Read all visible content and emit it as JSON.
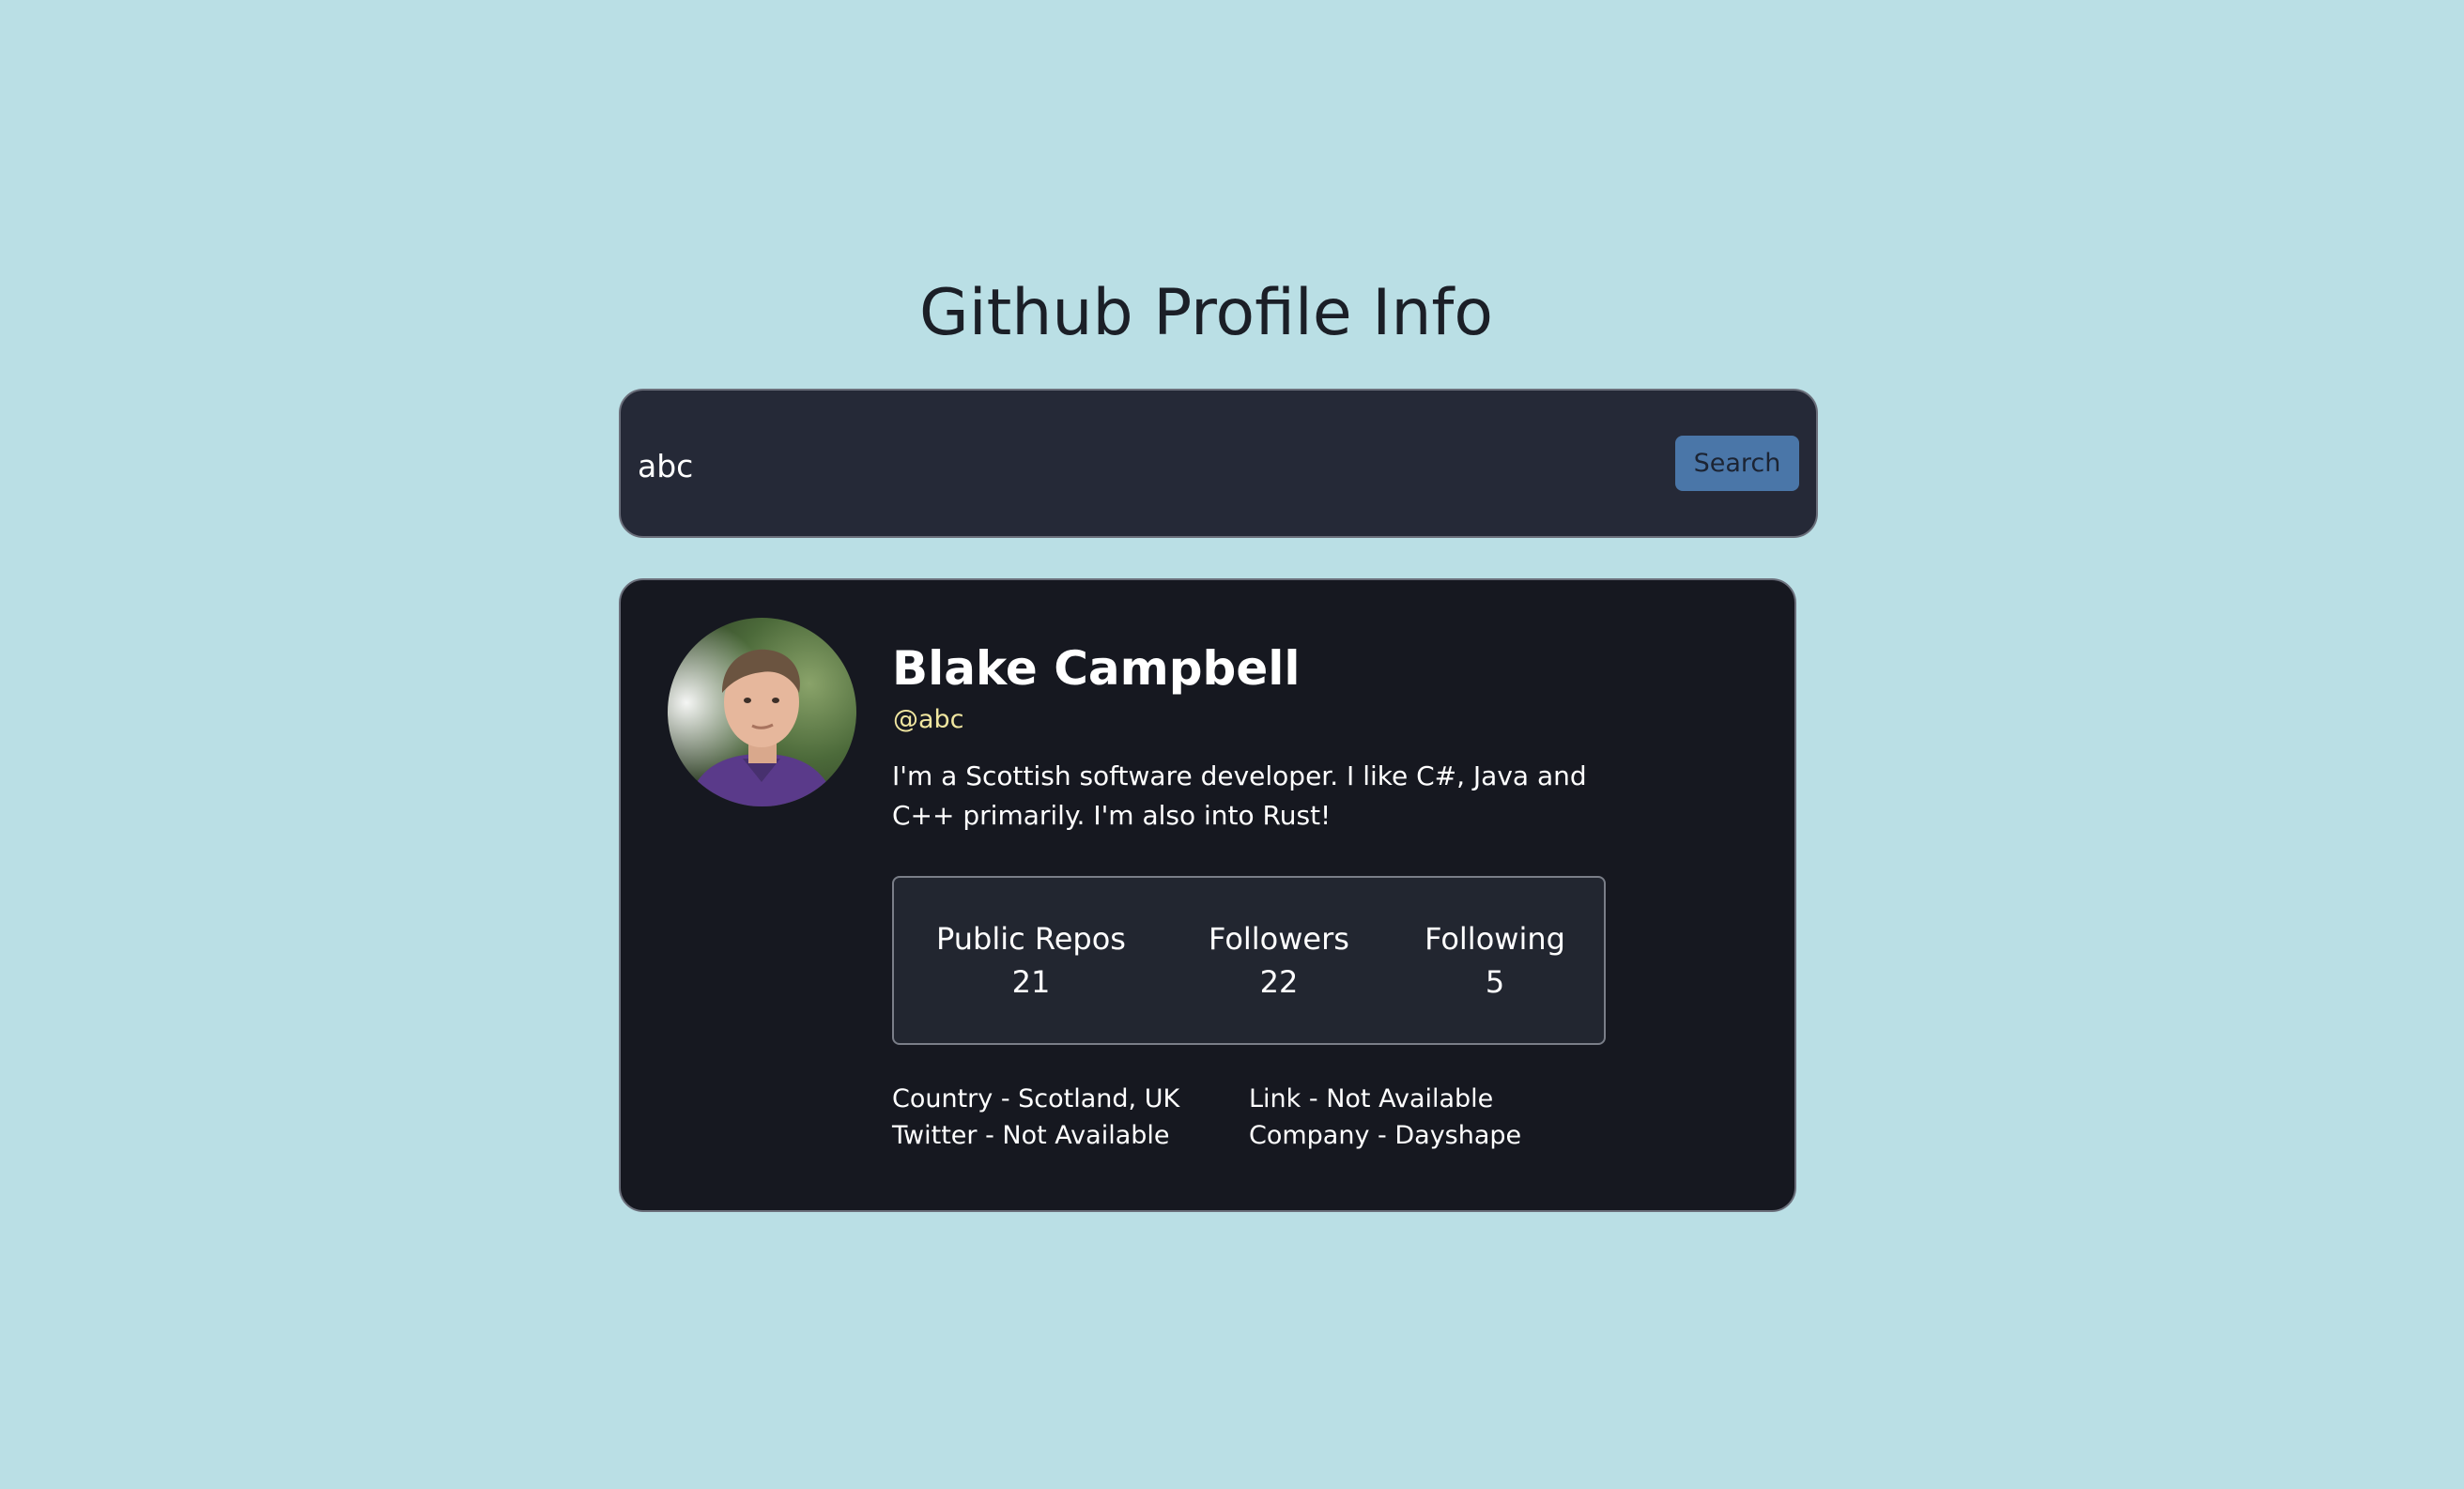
{
  "page": {
    "title": "Github Profile Info"
  },
  "search": {
    "value": "abc",
    "button_label": "Search"
  },
  "profile": {
    "avatar": "profile-photo",
    "name": "Blake Campbell",
    "username": "@abc",
    "bio": "I'm a Scottish software developer. I like C#, Java and C++ primarily. I'm also into Rust!",
    "stats": {
      "repos_label": "Public Repos",
      "repos_value": "21",
      "followers_label": "Followers",
      "followers_value": "22",
      "following_label": "Following",
      "following_value": "5"
    },
    "details": {
      "country": "Country - Scotland, UK",
      "twitter": "Twitter - Not Available",
      "link": "Link - Not Available",
      "company": "Company - Dayshape"
    }
  },
  "colors": {
    "background": "#badfe5",
    "card": "#161820",
    "search_bar": "#252937",
    "button": "#4a76a8",
    "username": "#f0e6a0"
  }
}
